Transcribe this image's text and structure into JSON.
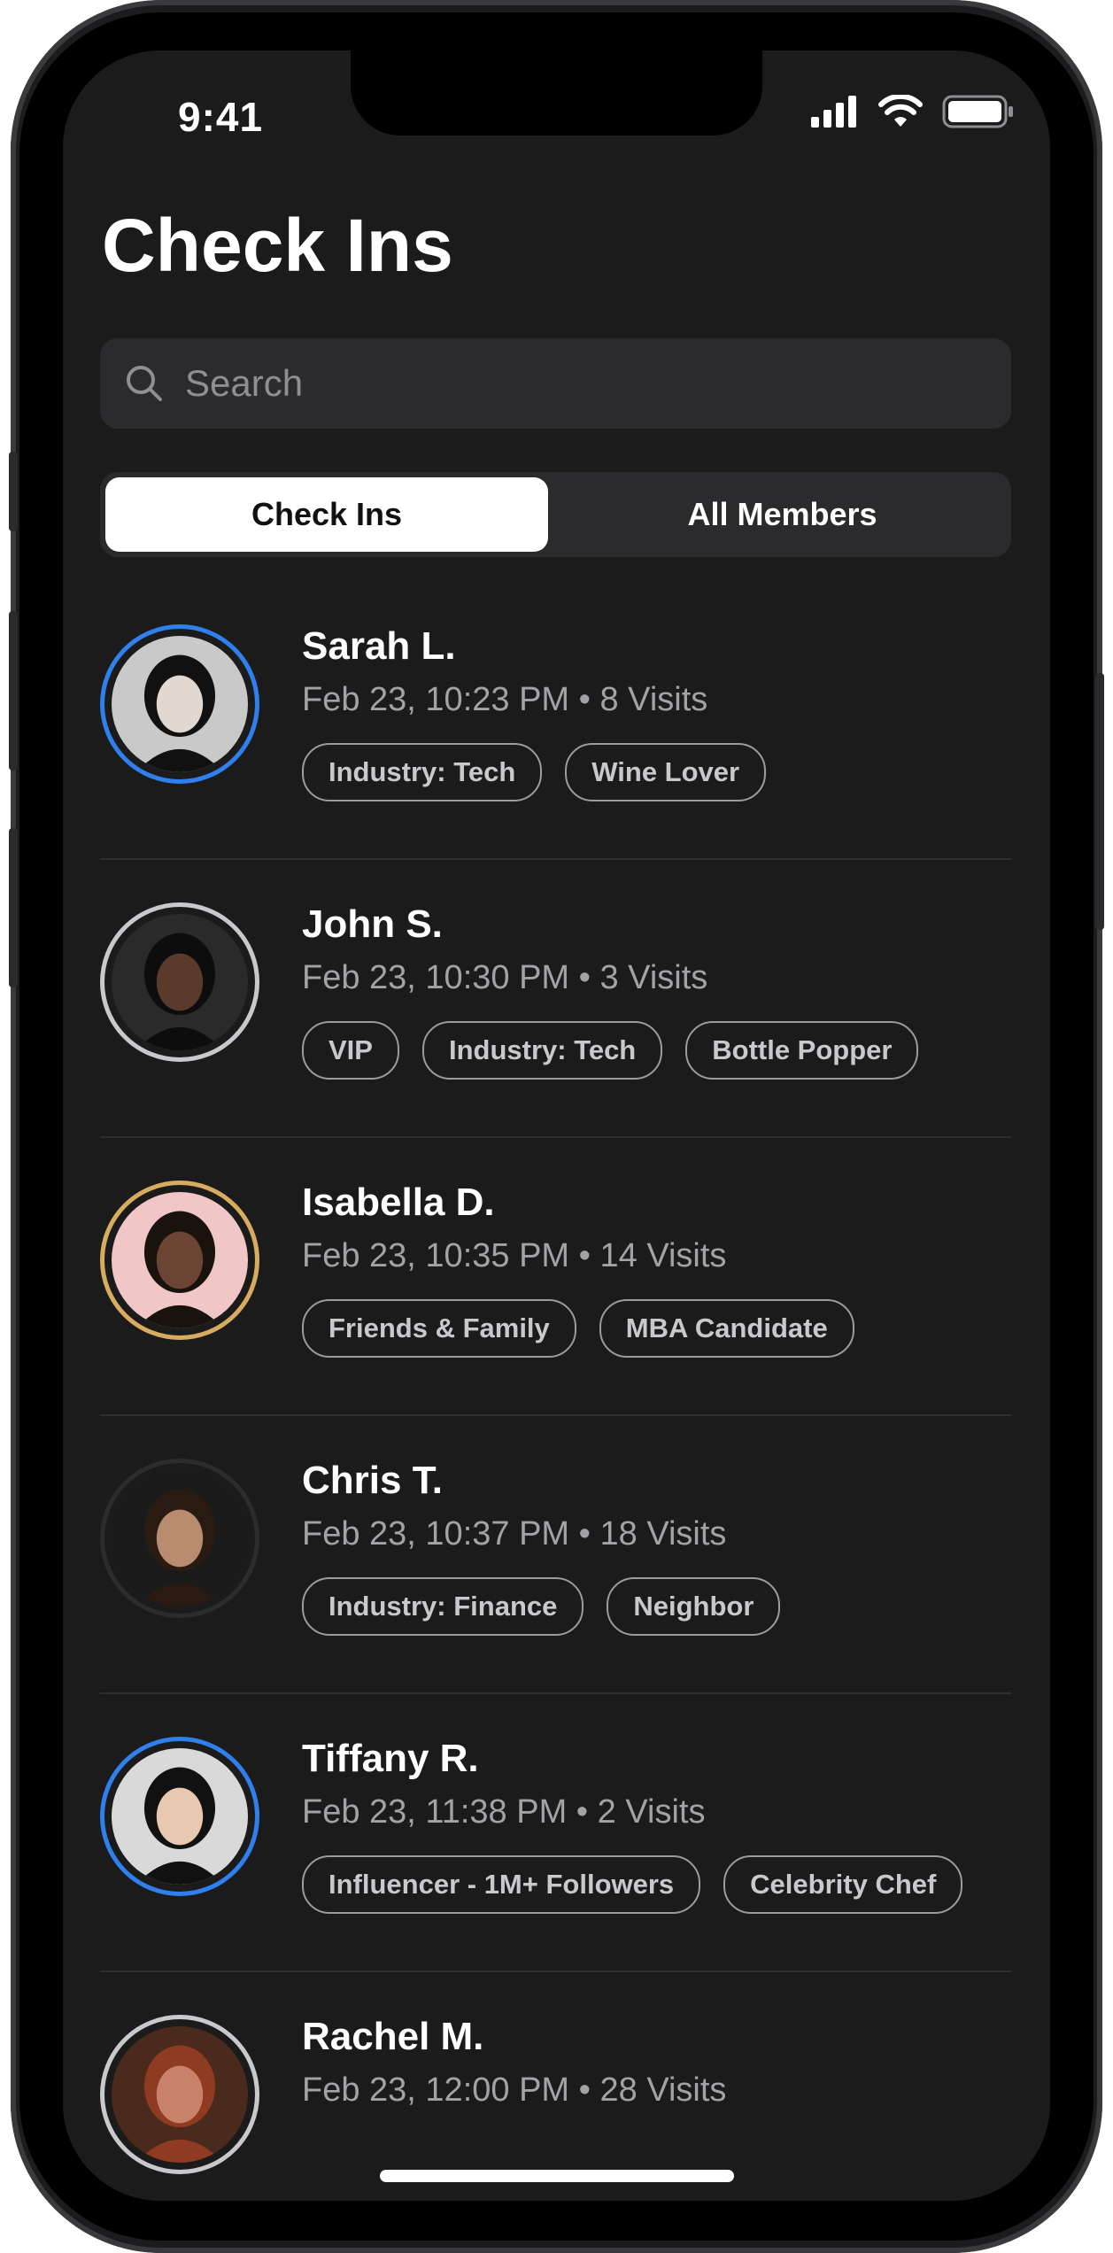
{
  "status_bar": {
    "time": "9:41"
  },
  "header": {
    "title": "Check Ins"
  },
  "search": {
    "placeholder": "Search"
  },
  "segments": {
    "active": "Check Ins",
    "inactive": "All Members"
  },
  "colors": {
    "ring_blue": "#2f80ed",
    "ring_silver": "#c9c9cd",
    "ring_gold": "#d8ac5e",
    "ring_dark": "#2c2c2e"
  },
  "members": [
    {
      "name": "Sarah L.",
      "meta": "Feb 23, 10:23 PM • 8 Visits",
      "ring": "blue",
      "tags": [
        "Industry: Tech",
        "Wine Lover"
      ]
    },
    {
      "name": "John S.",
      "meta": "Feb 23, 10:30 PM • 3 Visits",
      "ring": "silver",
      "tags": [
        "VIP",
        "Industry: Tech",
        "Bottle Popper"
      ]
    },
    {
      "name": "Isabella D.",
      "meta": "Feb 23, 10:35 PM • 14 Visits",
      "ring": "gold",
      "tags": [
        "Friends & Family",
        "MBA Candidate"
      ]
    },
    {
      "name": "Chris T.",
      "meta": "Feb 23, 10:37 PM • 18 Visits",
      "ring": "dark",
      "tags": [
        "Industry: Finance",
        "Neighbor"
      ]
    },
    {
      "name": "Tiffany R.",
      "meta": "Feb 23, 11:38 PM • 2 Visits",
      "ring": "blue",
      "tags": [
        "Influencer - 1M+ Followers",
        "Celebrity Chef"
      ]
    },
    {
      "name": "Rachel M.",
      "meta": "Feb 23, 12:00 PM • 28 Visits",
      "ring": "silver",
      "tags": []
    }
  ]
}
